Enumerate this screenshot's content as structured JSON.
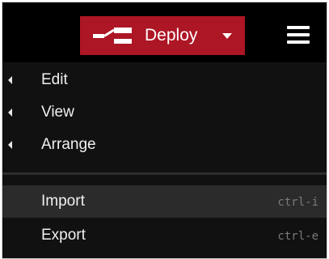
{
  "header": {
    "deploy": {
      "label": "Deploy",
      "icon": "deploy-icon",
      "caret_icon": "caret-down-icon"
    },
    "menu_button": {
      "icon": "hamburger-icon"
    }
  },
  "menu": {
    "items": [
      {
        "label": "Edit",
        "submenu": true,
        "icon": "chevron-left-icon"
      },
      {
        "label": "View",
        "submenu": true,
        "icon": "chevron-left-icon"
      },
      {
        "label": "Arrange",
        "submenu": true,
        "icon": "chevron-left-icon"
      },
      {
        "label": "Import",
        "shortcut": "ctrl-i",
        "highlighted": true
      },
      {
        "label": "Export",
        "shortcut": "ctrl-e"
      }
    ]
  },
  "colors": {
    "deploy_red": "#ad1625",
    "background": "#000000",
    "menu_background": "#111111",
    "highlight": "#2b2b2b",
    "shortcut_text": "#7a7a7a"
  }
}
